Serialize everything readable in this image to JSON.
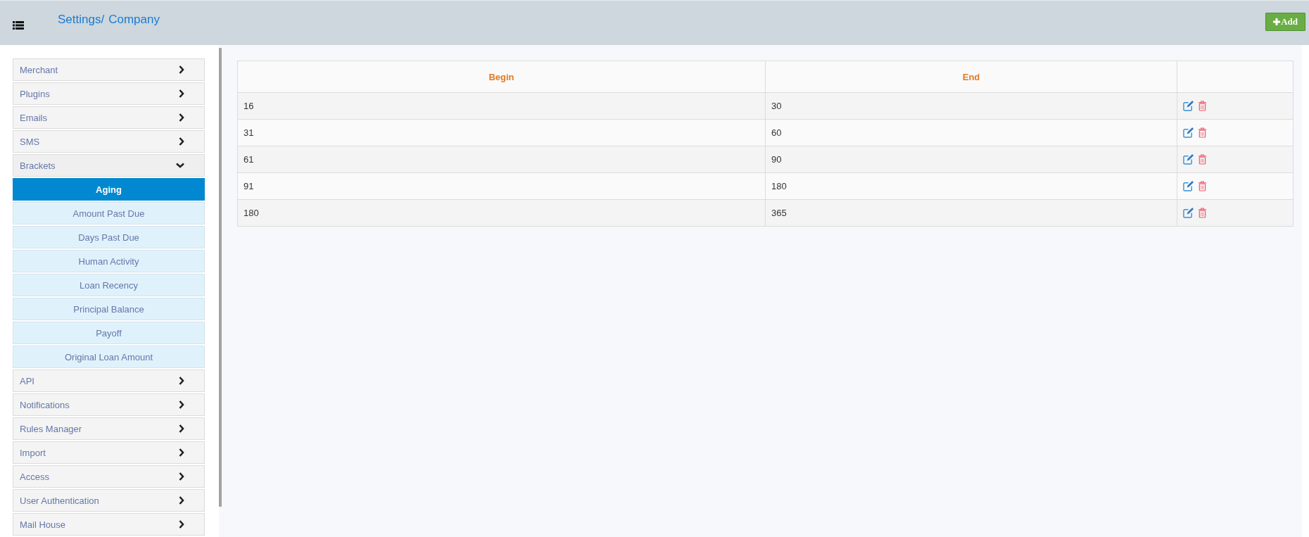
{
  "header": {
    "breadcrumb": [
      "Settings/",
      "Company"
    ],
    "add_button": "Add"
  },
  "sidebar": {
    "items": [
      {
        "label": "Merchant",
        "expanded": false
      },
      {
        "label": "Plugins",
        "expanded": false
      },
      {
        "label": "Emails",
        "expanded": false
      },
      {
        "label": "SMS",
        "expanded": false
      },
      {
        "label": "Brackets",
        "expanded": true,
        "children": [
          {
            "label": "Aging",
            "selected": true
          },
          {
            "label": "Amount Past Due",
            "selected": false
          },
          {
            "label": "Days Past Due",
            "selected": false
          },
          {
            "label": "Human Activity",
            "selected": false
          },
          {
            "label": "Loan Recency",
            "selected": false
          },
          {
            "label": "Principal Balance",
            "selected": false
          },
          {
            "label": "Payoff",
            "selected": false
          },
          {
            "label": "Original Loan Amount",
            "selected": false
          }
        ]
      },
      {
        "label": "API",
        "expanded": false
      },
      {
        "label": "Notifications",
        "expanded": false
      },
      {
        "label": "Rules Manager",
        "expanded": false
      },
      {
        "label": "Import",
        "expanded": false
      },
      {
        "label": "Access",
        "expanded": false
      },
      {
        "label": "User Authentication",
        "expanded": false
      },
      {
        "label": "Mail House",
        "expanded": false
      }
    ]
  },
  "table": {
    "columns": [
      "Begin",
      "End"
    ],
    "rows": [
      [
        "16",
        "30"
      ],
      [
        "31",
        "60"
      ],
      [
        "61",
        "90"
      ],
      [
        "91",
        "180"
      ],
      [
        "180",
        "365"
      ]
    ]
  }
}
